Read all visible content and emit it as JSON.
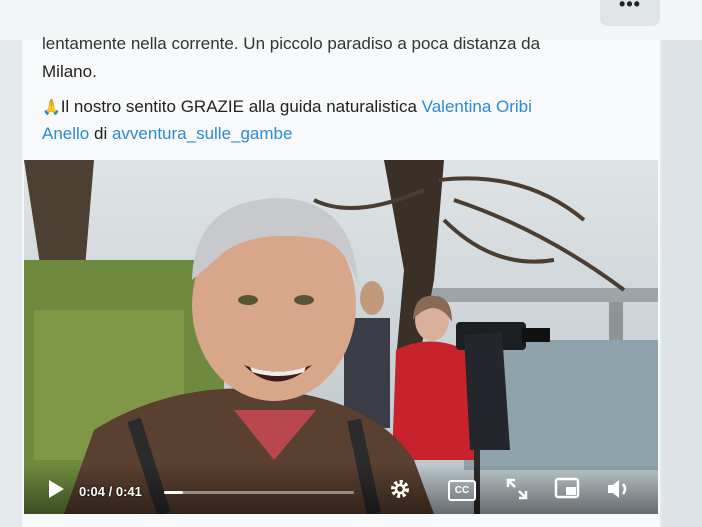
{
  "toolbar": {
    "more_label": "•••"
  },
  "post": {
    "line_cut": "lentamente nella corrente. Un piccolo paradiso a poca distanza da",
    "line_2": "Milano.",
    "emoji": "🙏",
    "thanks_text": "Il nostro sentito GRAZIE alla guida naturalistica ",
    "guide_name_part1": "Valentina Oribi",
    "guide_name_part2": "Anello",
    "connector": " di ",
    "org_link": "avventura_sulle_gambe"
  },
  "video": {
    "current_time": "0:04",
    "separator": " / ",
    "duration": "0:41",
    "progress_fraction": 0.098,
    "icons": [
      "play-icon",
      "settings-gear-icon",
      "captions-icon",
      "fullscreen-icon",
      "picture-in-picture-icon",
      "volume-icon"
    ],
    "cc_label": "CC"
  },
  "colors": {
    "link": "#2a8bd6",
    "text": "#222222",
    "jacket_red": "#c8232b"
  }
}
